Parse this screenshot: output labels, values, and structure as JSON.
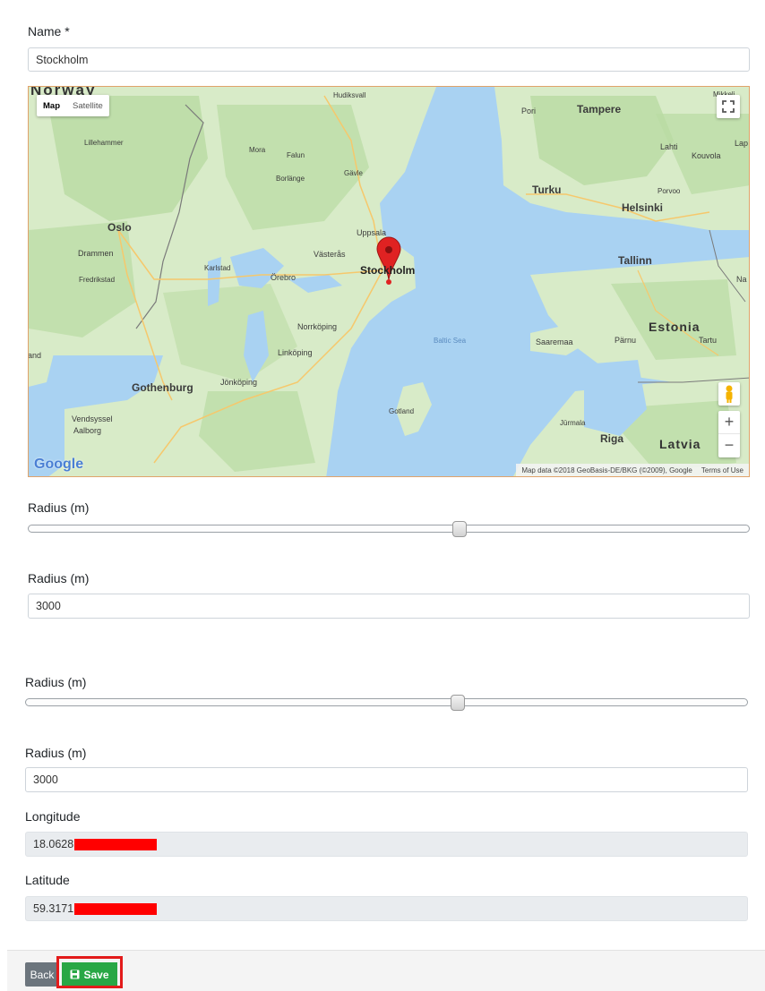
{
  "form_top": {
    "name_label": "Name *",
    "name_value": "Stockholm",
    "radius_slider_label": "Radius (m)",
    "radius_slider_fraction": 0.6,
    "radius_input_label": "Radius (m)",
    "radius_value": "3000"
  },
  "map": {
    "type_buttons": [
      "Map",
      "Satellite"
    ],
    "places": {
      "norway": "Norway",
      "hudiksvall": "Hudiksvall",
      "lillehammer": "Lillehammer",
      "mora": "Mora",
      "falun": "Falun",
      "gavle": "Gävle",
      "borlange": "Borlänge",
      "oslo": "Oslo",
      "drammen": "Drammen",
      "fredrikstad": "Fredrikstad",
      "karlstad": "Karlstad",
      "orebro": "Örebro",
      "vasteras": "Västerås",
      "uppsala": "Uppsala",
      "stockholm": "Stockholm",
      "norrkoping": "Norrköping",
      "linkoping": "Linköping",
      "jonkoping": "Jönköping",
      "gothenburg": "Gothenburg",
      "vendsyssel": "Vendsyssel",
      "aalborg": "Aalborg",
      "and": "and",
      "baltic_sea": "Baltic Sea",
      "gotland": "Gotland",
      "pori": "Pori",
      "tampere": "Tampere",
      "lahti": "Lahti",
      "kouvola": "Kouvola",
      "lap": "Lap",
      "turku": "Turku",
      "porvoo": "Porvoo",
      "helsinki": "Helsinki",
      "mikkeli": "Mikkeli",
      "tallinn": "Tallinn",
      "na": "Na",
      "estonia": "Estonia",
      "saaremaa": "Saaremaa",
      "parnu": "Pärnu",
      "tartu": "Tartu",
      "riga": "Riga",
      "jurmala": "Jūrmala",
      "latvia": "Latvia"
    },
    "logo": "Google",
    "attribution": "Map data ©2018 GeoBasis-DE/BKG (©2009), Google",
    "terms": "Terms of Use",
    "zoom_in": "+",
    "zoom_out": "−",
    "colors": {
      "water": "#a9d2f2",
      "land": "#d8ebc8",
      "forest": "#b9dba3",
      "urban": "#f0eadf",
      "road": "#f6c86c",
      "border": "#7a7a7a",
      "marker": "#e02222"
    }
  },
  "form_bottom": {
    "radius_slider_label": "Radius (m)",
    "radius_slider_fraction": 0.6,
    "radius_input_label": "Radius (m)",
    "radius_value": "3000",
    "longitude_label": "Longitude",
    "longitude_value": "18.0628",
    "latitude_label": "Latitude",
    "latitude_value": "59.3171"
  },
  "footer": {
    "back_label": "Back",
    "save_label": "Save",
    "save_color": "#28a745",
    "highlight_color": "#e31b1b",
    "redaction_color": "#ff0000"
  }
}
